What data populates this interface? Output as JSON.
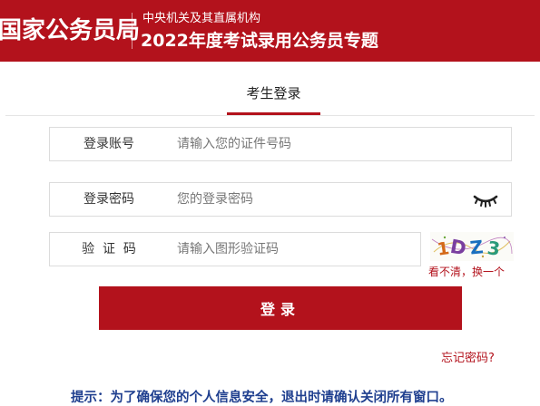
{
  "header": {
    "brand": "国家公务员局",
    "subtitle": "中央机关及其直属机构",
    "title": "2022年度考试录用公务员专题"
  },
  "tab": {
    "label": "考生登录"
  },
  "form": {
    "account": {
      "label": "登录账号",
      "placeholder": "请输入您的证件号码"
    },
    "password": {
      "label": "登录密码",
      "placeholder": "您的登录密码"
    },
    "captcha": {
      "label": "验  证  码",
      "placeholder": "请输入图形验证码",
      "refresh_text": "看不清，换一个"
    },
    "submit_label": "登录",
    "forgot_label": "忘记密码?"
  },
  "tip": "提示：为了确保您的个人信息安全，退出时请确认关闭所有窗口。",
  "colors": {
    "brand": "#b3121c",
    "tip": "#1f3f8f"
  },
  "icons": {
    "password_toggle": "eye-closed-icon"
  }
}
